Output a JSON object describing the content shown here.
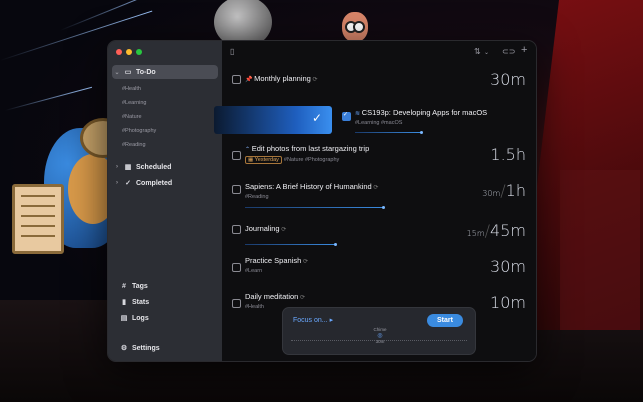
{
  "sidebar": {
    "todo": {
      "label": "To-Do"
    },
    "tags": [
      "#Health",
      "#Learning",
      "#Nature",
      "#Photography",
      "#Reading"
    ],
    "scheduled": {
      "label": "Scheduled"
    },
    "completed": {
      "label": "Completed"
    },
    "bottom": {
      "tags": "Tags",
      "stats": "Stats",
      "logs": "Logs",
      "settings": "Settings"
    }
  },
  "tasks": [
    {
      "title": "Monthly planning",
      "tags": "",
      "duration": "30m"
    },
    {
      "title": "CS193p: Developing Apps for macOS",
      "tags": "#Learning #macOS",
      "duration": ""
    },
    {
      "title": "Edit photos from last stargazing trip",
      "badge": "Yesterday",
      "tags": "#Nature #Photography",
      "duration": "1.5h"
    },
    {
      "title": "Sapiens: A Brief History of Humankind",
      "tags": "#Reading",
      "duration_small": "30m",
      "duration": "1h"
    },
    {
      "title": "Journaling",
      "tags": "",
      "duration_small": "15m",
      "duration": "45m"
    },
    {
      "title": "Practice Spanish",
      "tags": "#Learn",
      "duration": "30m"
    },
    {
      "title": "Daily meditation",
      "tags": "#Health",
      "duration": "10m"
    }
  ],
  "focus": {
    "label": "Focus on... ▸",
    "start": "Start",
    "sound": "Chime",
    "sound_value": "30m"
  },
  "colors": {
    "accent": "#3a8be0",
    "sidebar_bg": "#2e3036",
    "main_bg": "#0e0e10"
  }
}
